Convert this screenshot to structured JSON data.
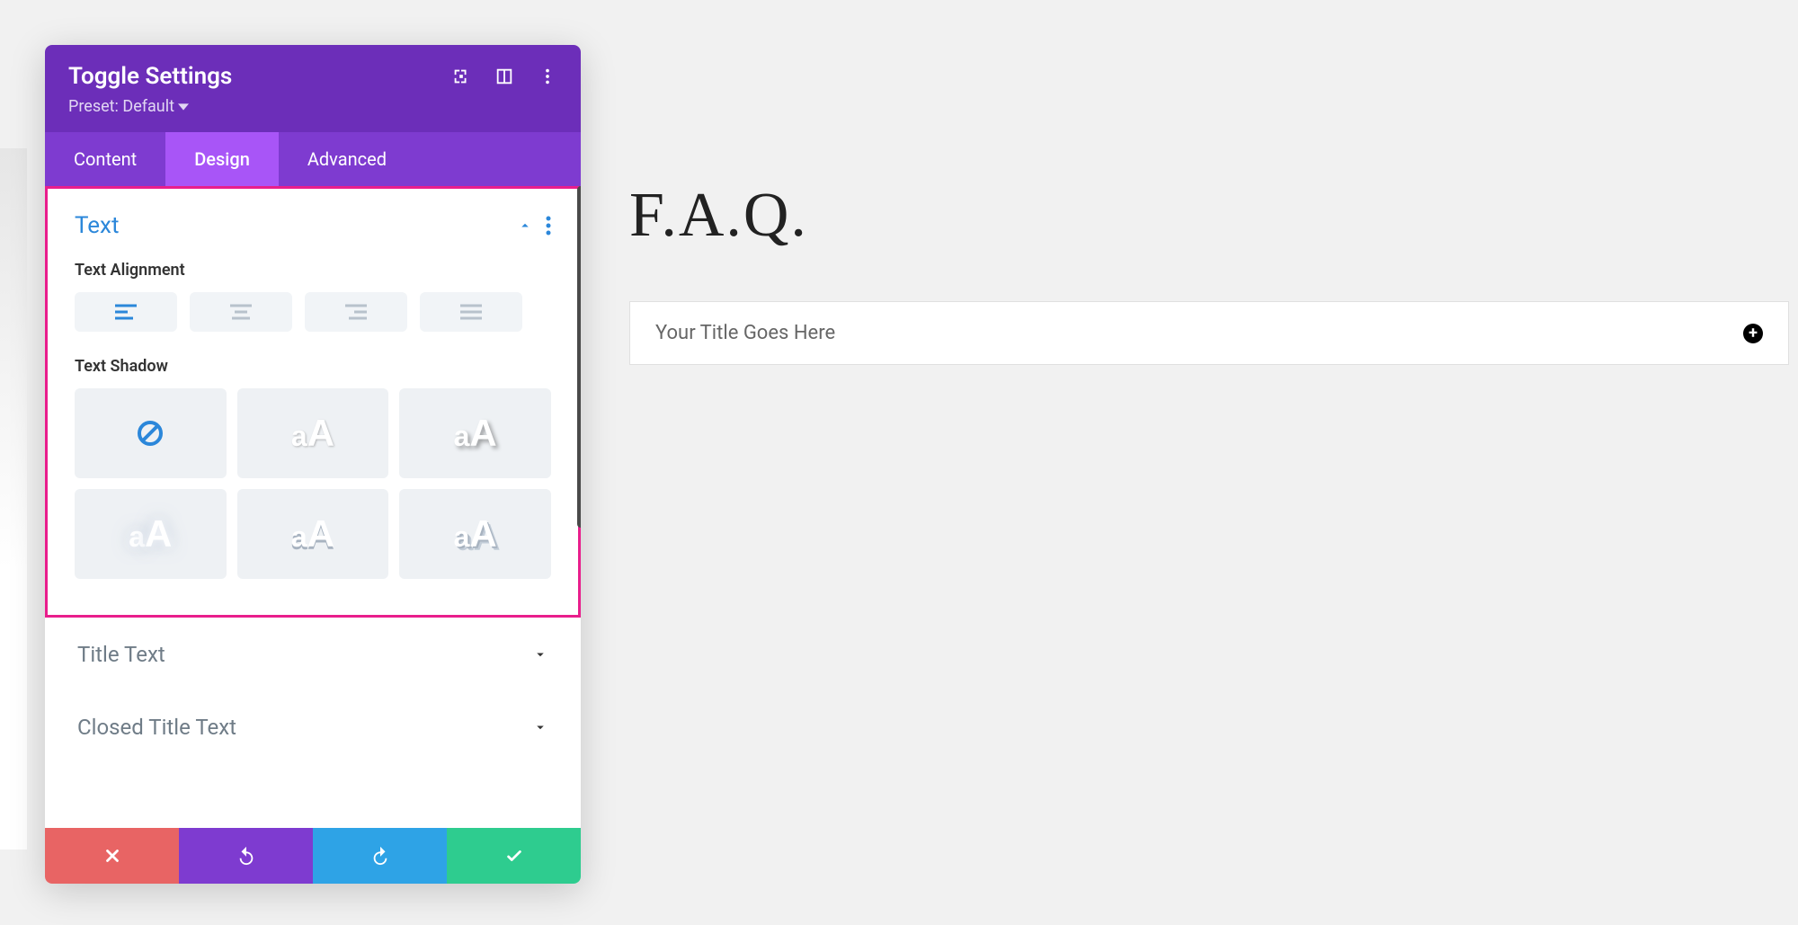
{
  "panel": {
    "title": "Toggle Settings",
    "preset_label": "Preset: Default"
  },
  "tabs": {
    "content": "Content",
    "design": "Design",
    "advanced": "Advanced"
  },
  "sections": {
    "text": "Text",
    "text_alignment": "Text Alignment",
    "text_shadow": "Text Shadow",
    "title_text": "Title Text",
    "closed_title_text": "Closed Title Text"
  },
  "shadow_sample": "aA",
  "preview": {
    "heading": "F.A.Q.",
    "toggle_title": "Your Title Goes Here"
  }
}
